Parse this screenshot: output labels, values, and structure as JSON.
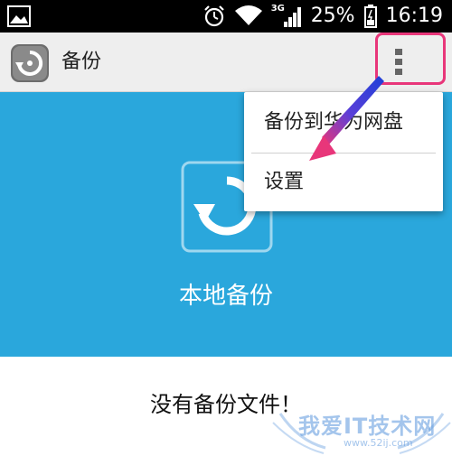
{
  "status_bar": {
    "network": "3G",
    "battery": "25%",
    "time": "16:19",
    "icons": [
      "image-icon",
      "alarm-icon",
      "wifi-icon",
      "signal-icon",
      "battery-icon"
    ]
  },
  "action_bar": {
    "title": "备份",
    "app_icon": "backup-restore-icon",
    "overflow_icon": "more-vertical-icon"
  },
  "header": {
    "label": "本地备份",
    "icon": "refresh-icon"
  },
  "menu": {
    "items": [
      {
        "label": "备份到华为网盘"
      },
      {
        "label": "设置"
      }
    ]
  },
  "content": {
    "empty_message": "没有备份文件！"
  },
  "watermark": {
    "main": "我爱IT技术网",
    "sub": "www.52ij.com"
  },
  "colors": {
    "header_blue": "#2aa7dc",
    "highlight_pink": "#e8367a",
    "arrow_blue": "#1e3fd8"
  }
}
